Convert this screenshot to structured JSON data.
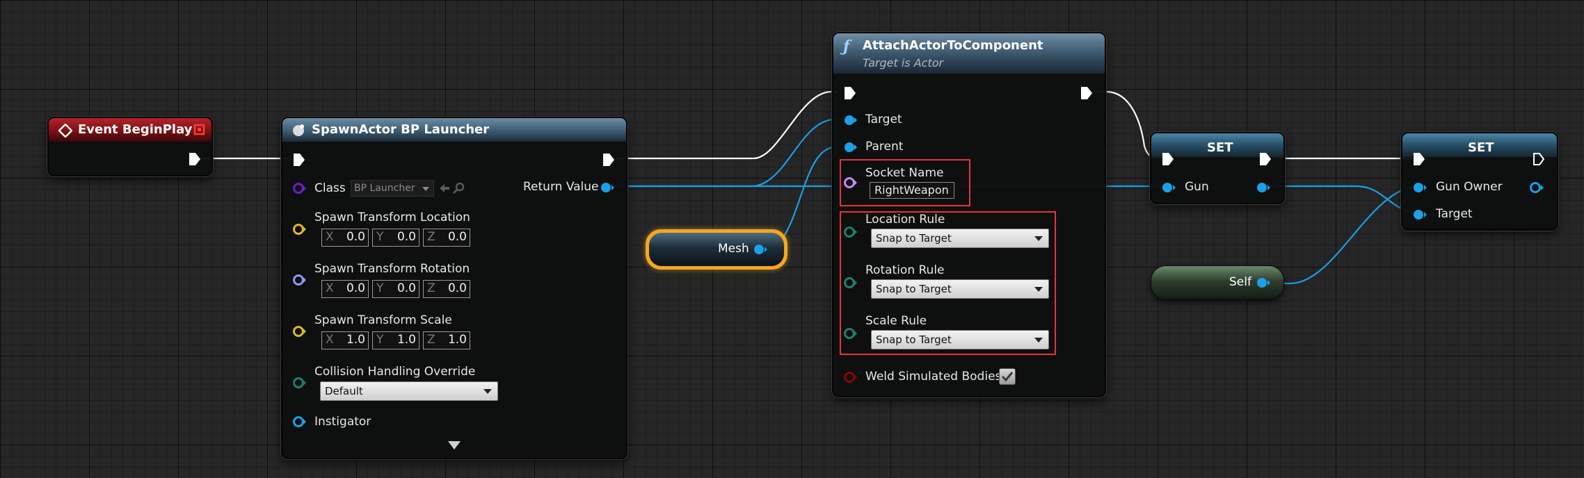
{
  "colors": {
    "exec": "#ffffff",
    "object": "#00a8f0",
    "class": "#6a1fc9",
    "vector": "#e0b52c",
    "rotator": "#8c9cf2",
    "enum": "#1f7e74",
    "name": "#c886ff",
    "bool": "#920101",
    "highlight": "#e8343c",
    "selected": "#f5a623"
  },
  "event_node": {
    "title": "Event BeginPlay",
    "icon": "event-diamond-icon"
  },
  "spawn_node": {
    "title": "SpawnActor BP Launcher",
    "icon": "spawn-actor-icon",
    "class_label": "Class",
    "class_value": "BP Launcher",
    "return_label": "Return Value",
    "location_label": "Spawn Transform Location",
    "location": {
      "x": "0.0",
      "y": "0.0",
      "z": "0.0"
    },
    "rotation_label": "Spawn Transform Rotation",
    "rotation": {
      "x": "0.0",
      "y": "0.0",
      "z": "0.0"
    },
    "scale_label": "Spawn Transform Scale",
    "scale": {
      "x": "1.0",
      "y": "1.0",
      "z": "1.0"
    },
    "axis_x": "X",
    "axis_y": "Y",
    "axis_z": "Z",
    "collision_label": "Collision Handling Override",
    "collision_value": "Default",
    "instigator_label": "Instigator"
  },
  "mesh_node": {
    "label": "Mesh"
  },
  "attach_node": {
    "title": "AttachActorToComponent",
    "subtitle": "Target is Actor",
    "icon": "function-icon",
    "target_label": "Target",
    "parent_label": "Parent",
    "socket_label": "Socket Name",
    "socket_value": "RightWeapon",
    "location_rule_label": "Location Rule",
    "location_rule_value": "Snap to Target",
    "rotation_rule_label": "Rotation Rule",
    "rotation_rule_value": "Snap to Target",
    "scale_rule_label": "Scale Rule",
    "scale_rule_value": "Snap to Target",
    "weld_label": "Weld Simulated Bodies",
    "weld_checked": true
  },
  "set_gun_node": {
    "title": "SET",
    "gun_label": "Gun"
  },
  "self_node": {
    "label": "Self"
  },
  "set_owner_node": {
    "title": "SET",
    "owner_label": "Gun Owner",
    "target_label": "Target"
  }
}
